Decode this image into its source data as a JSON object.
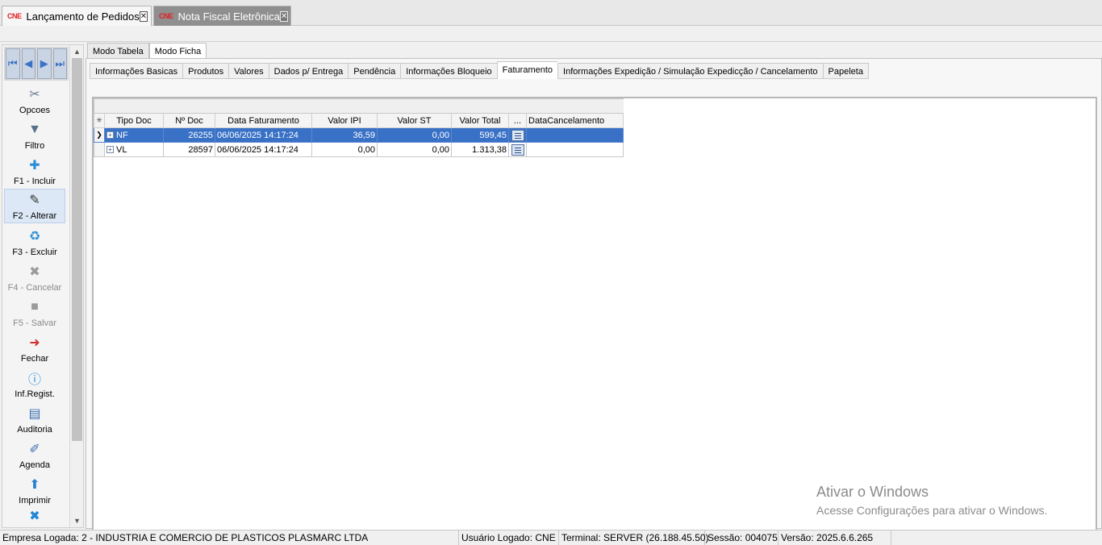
{
  "doc_tabs": [
    {
      "logo": "CNE",
      "label": "Lançamento de Pedidos"
    },
    {
      "logo": "CNE",
      "label": "Nota Fiscal Eletrônica"
    }
  ],
  "sidebar": {
    "items": [
      {
        "label": "Opcoes",
        "icon": "tools-icon"
      },
      {
        "label": "Filtro",
        "icon": "funnel-icon"
      },
      {
        "label": "F1 - Incluir",
        "icon": "add-document-icon"
      },
      {
        "label": "F2 - Alterar",
        "icon": "edit-document-icon"
      },
      {
        "label": "F3 - Excluir",
        "icon": "recycle-bin-icon"
      },
      {
        "label": "F4 - Cancelar",
        "icon": "x-icon"
      },
      {
        "label": "F5 - Salvar",
        "icon": "save-icon"
      },
      {
        "label": "Fechar",
        "icon": "exit-icon"
      },
      {
        "label": "Inf.Regist.",
        "icon": "info-icon"
      },
      {
        "label": "Auditoria",
        "icon": "clipboard-icon"
      },
      {
        "label": "Agenda",
        "icon": "book-icon"
      },
      {
        "label": "Imprimir",
        "icon": "print-icon"
      }
    ]
  },
  "mode_tabs": [
    "Modo Tabela",
    "Modo Ficha"
  ],
  "sub_tabs": [
    "Informações Basicas",
    "Produtos",
    "Valores",
    "Dados p/ Entrega",
    "Pendência",
    "Informações Bloqueio",
    "Faturamento",
    "Informações Expedição / Simulação Expedicção / Cancelamento",
    "Papeleta"
  ],
  "grid": {
    "columns": [
      "Tipo Doc",
      "Nº Doc",
      "Data Faturamento",
      "Valor IPI",
      "Valor ST",
      "Valor Total",
      "...",
      "DataCancelamento"
    ],
    "rows": [
      {
        "tipo": "NF",
        "num": "26255",
        "data": "06/06/2025 14:17:24",
        "ipi": "36,59",
        "st": "0,00",
        "total": "599,45",
        "cancel": ""
      },
      {
        "tipo": "VL",
        "num": "28597",
        "data": "06/06/2025 14:17:24",
        "ipi": "0,00",
        "st": "0,00",
        "total": "1.313,38",
        "cancel": ""
      }
    ]
  },
  "watermark": {
    "line1": "Ativar o Windows",
    "line2": "Acesse Configurações para ativar o Windows."
  },
  "status": {
    "empresa": "Empresa Logada: 2 - INDUSTRIA E COMERCIO DE PLASTICOS PLASMARC LTDA",
    "usuario": "Usuário Logado: CNE",
    "terminal": "Terminal: SERVER (26.188.45.50)",
    "sessao": "Sessão: 004075",
    "versao": "Versão: 2025.6.6.265"
  },
  "colors": {
    "selection": "#3971c6",
    "accent_blue": "#3a73c5"
  }
}
